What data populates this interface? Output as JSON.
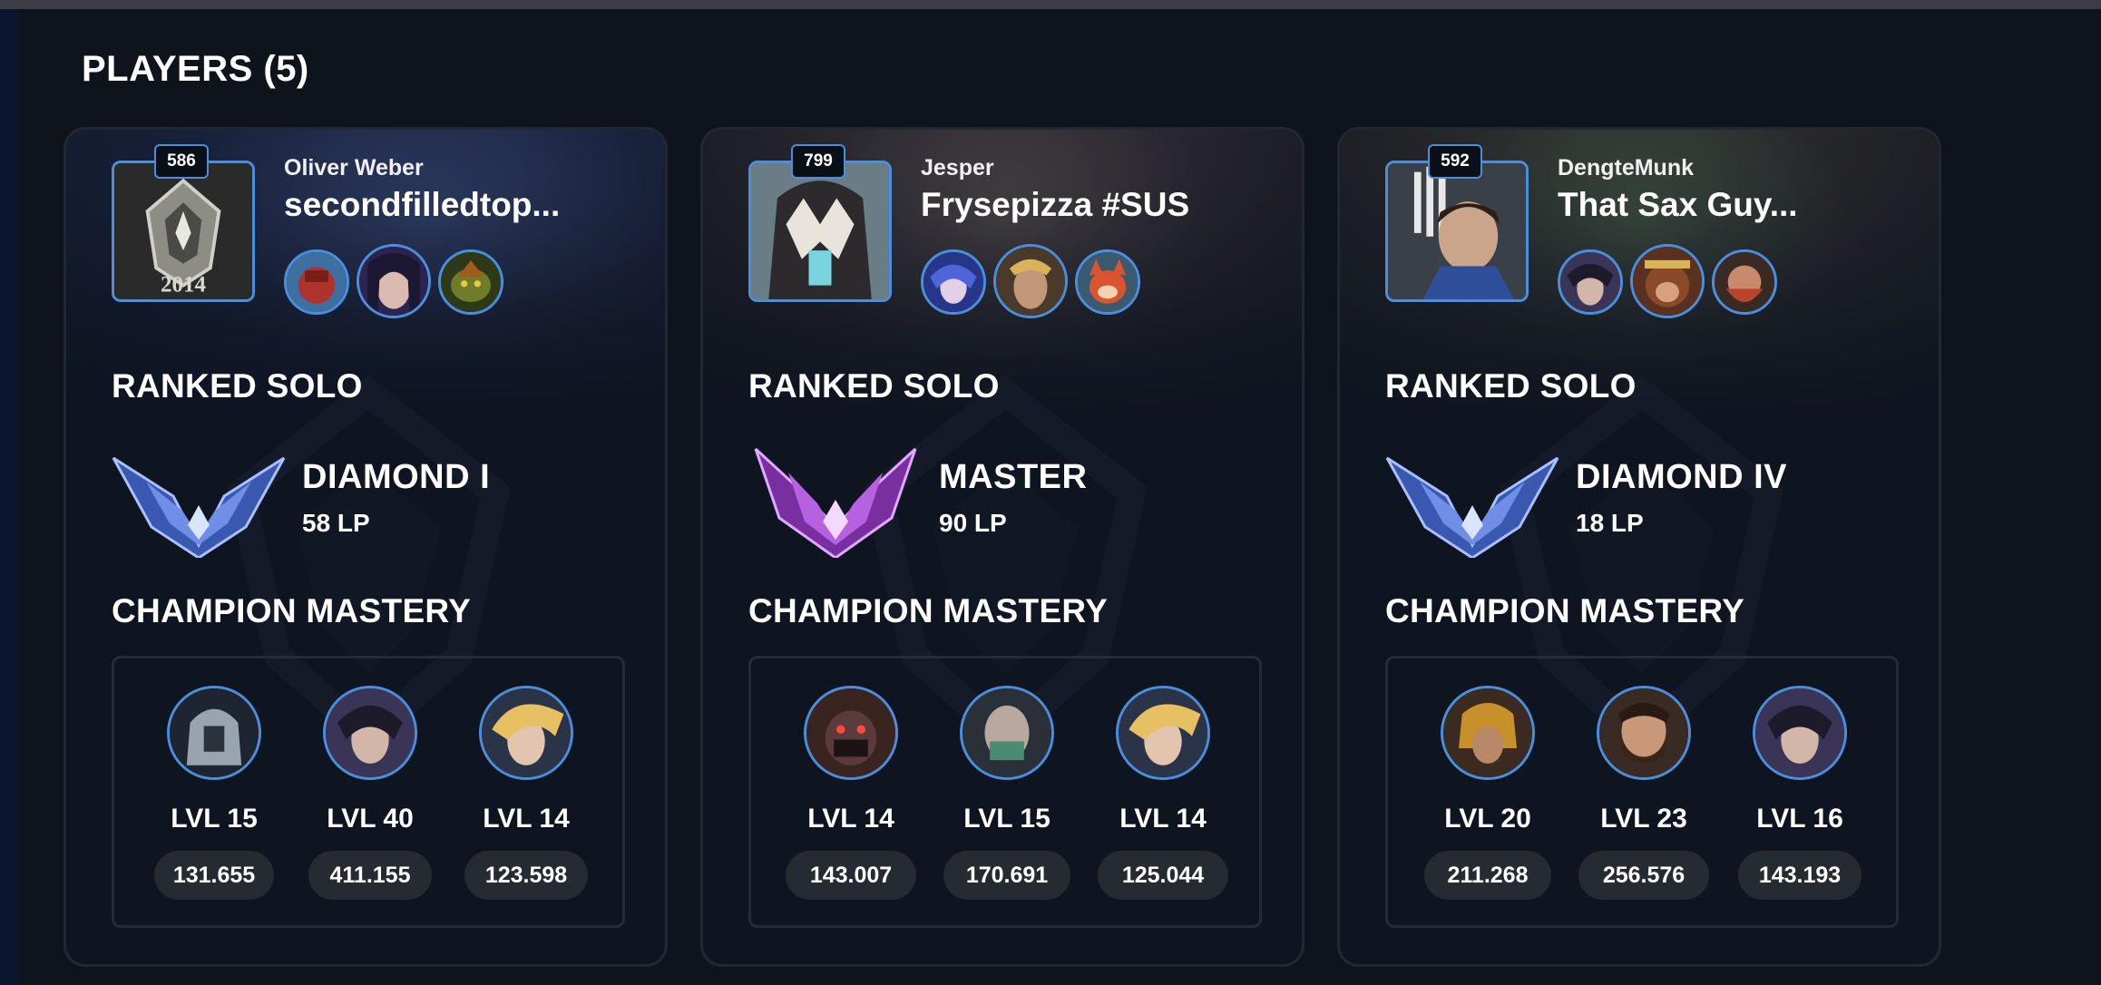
{
  "section": {
    "title": "PLAYERS (5)"
  },
  "labels": {
    "ranked": "RANKED SOLO",
    "mastery": "CHAMPION MASTERY"
  },
  "colors": {
    "accent": "#4b8fdc",
    "background": "#0f131c",
    "card": "#0e1420",
    "chip": "#262a31"
  },
  "players": [
    {
      "level": "586",
      "name": "Oliver Weber",
      "riot_id": "secondfilledtop...",
      "avatar_icon": "silver-2014-trophy-icon",
      "avatar_text": "2014",
      "recent_champions": [
        "red-armored-champion-icon",
        "dark-haired-champion-icon",
        "green-beast-champion-icon"
      ],
      "rank": {
        "tier": "DIAMOND I",
        "lp": "58 LP",
        "emblem": "diamond-emblem-icon"
      },
      "mastery": [
        {
          "level": "LVL 15",
          "points": "131.655",
          "icon": "silver-helmet-champion-icon"
        },
        {
          "level": "LVL 40",
          "points": "411.155",
          "icon": "dark-swordsman-champion-icon"
        },
        {
          "level": "LVL 14",
          "points": "123.598",
          "icon": "blonde-champion-icon"
        }
      ]
    },
    {
      "level": "799",
      "name": "Jesper",
      "riot_id": "Frysepizza #SUS",
      "avatar_icon": "pale-hooded-champion-icon",
      "avatar_text": "",
      "recent_champions": [
        "blue-mage-champion-icon",
        "golden-warrior-champion-icon",
        "red-fox-champion-icon"
      ],
      "rank": {
        "tier": "MASTER",
        "lp": "90 LP",
        "emblem": "master-emblem-icon"
      },
      "mastery": [
        {
          "level": "LVL 14",
          "points": "143.007",
          "icon": "masked-brute-champion-icon"
        },
        {
          "level": "LVL 15",
          "points": "170.691",
          "icon": "bald-masked-champion-icon"
        },
        {
          "level": "LVL 14",
          "points": "125.044",
          "icon": "blonde-champion-icon"
        }
      ]
    },
    {
      "level": "592",
      "name": "DengteMunk",
      "riot_id": "That Sax Guy...",
      "avatar_icon": "sword-warrior-champion-icon",
      "avatar_text": "",
      "recent_champions": [
        "dark-swordsman-champion-icon",
        "monkey-champion-icon",
        "dwarf-champion-icon"
      ],
      "rank": {
        "tier": "DIAMOND IV",
        "lp": "18 LP",
        "emblem": "diamond-emblem-icon"
      },
      "mastery": [
        {
          "level": "LVL 20",
          "points": "211.268",
          "icon": "golden-helmet-champion-icon"
        },
        {
          "level": "LVL 23",
          "points": "256.576",
          "icon": "bearded-champion-icon"
        },
        {
          "level": "LVL 16",
          "points": "143.193",
          "icon": "dark-swordsman-champion-icon"
        }
      ]
    }
  ]
}
